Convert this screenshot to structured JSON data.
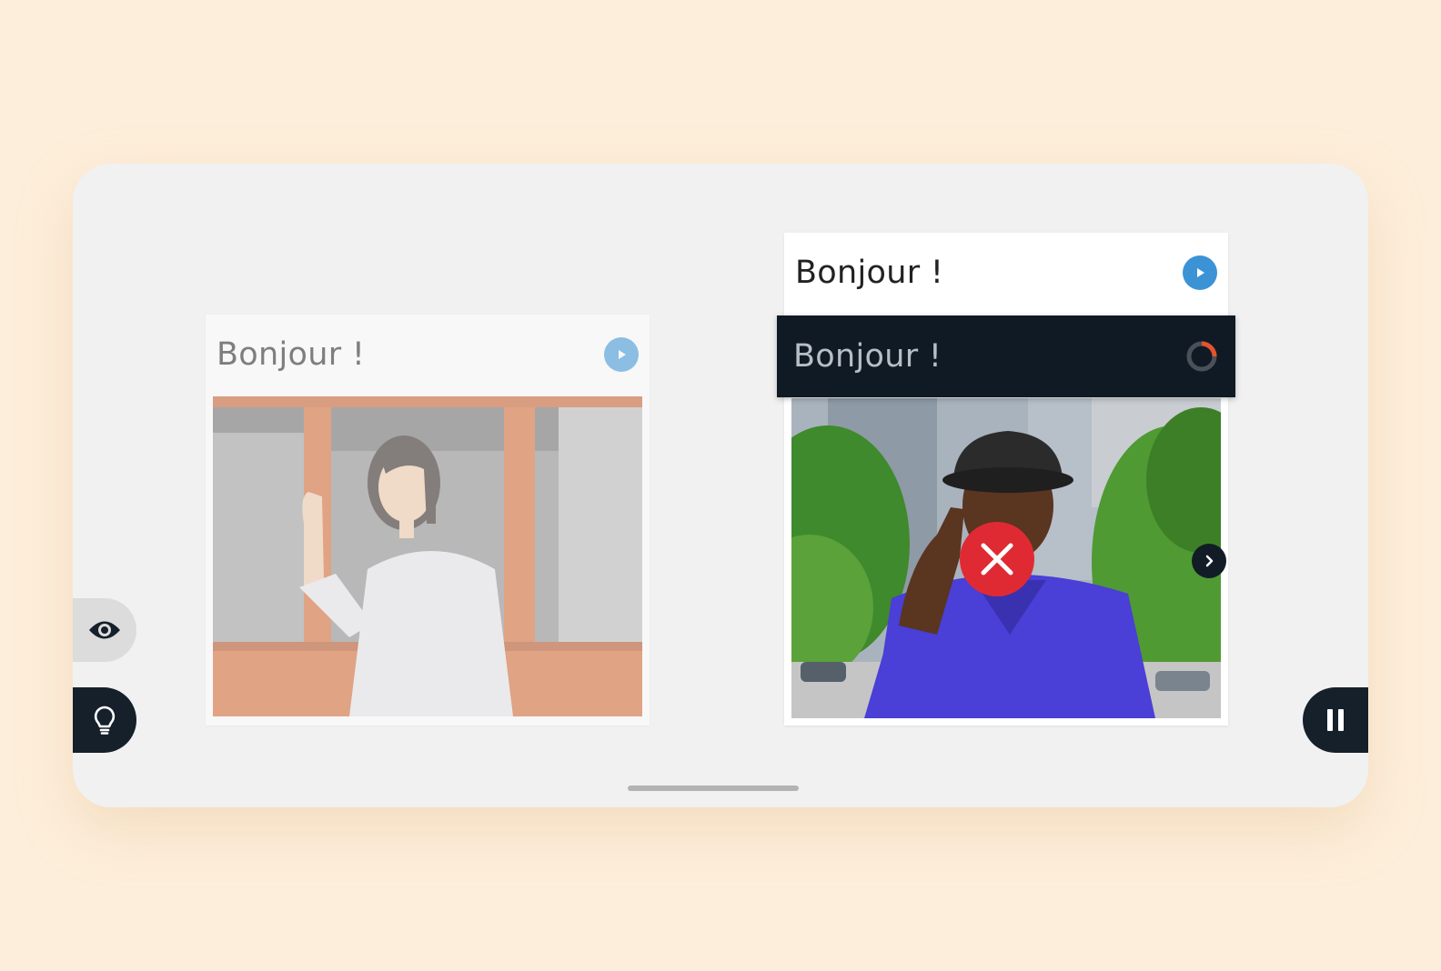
{
  "left_card": {
    "caption": "Bonjour !",
    "play_icon": "play-icon"
  },
  "right_card": {
    "caption": "Bonjour !",
    "play_icon": "play-icon"
  },
  "drag_caption": {
    "text": "Bonjour !",
    "status_icon": "loading-spinner-icon"
  },
  "feedback": {
    "icon": "incorrect-x-icon",
    "color": "#e02a33"
  },
  "controls": {
    "eye_icon": "eye-icon",
    "hint_icon": "lightbulb-icon",
    "pause_icon": "pause-icon",
    "next_icon": "chevron-right-icon"
  },
  "colors": {
    "background": "#fdeedb",
    "panel": "#f1f1f1",
    "accent_blue": "#3b93d6",
    "dark": "#15202b",
    "incorrect_red": "#e02a33"
  }
}
